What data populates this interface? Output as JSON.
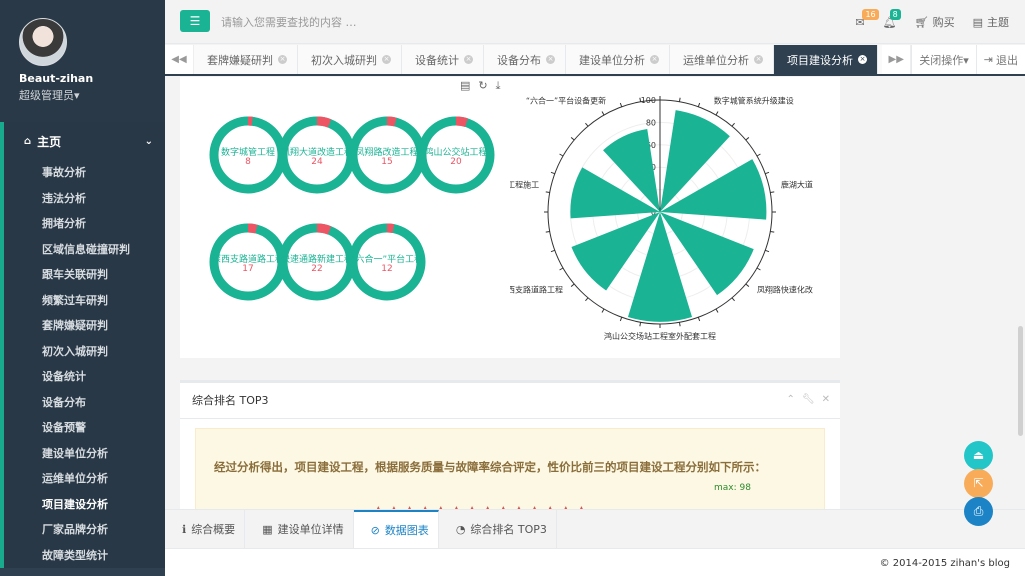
{
  "user": {
    "name": "Beaut-zihan",
    "role": "超级管理员▾"
  },
  "nav": {
    "section": "主页",
    "items": [
      "事故分析",
      "违法分析",
      "拥堵分析",
      "区域信息碰撞研判",
      "跟车关联研判",
      "频繁过车研判",
      "套牌嫌疑研判",
      "初次入城研判",
      "设备统计",
      "设备分布",
      "设备预警",
      "建设单位分析",
      "运维单位分析",
      "项目建设分析",
      "厂家品牌分析",
      "故障类型统计"
    ]
  },
  "search": {
    "placeholder": "请输入您需要查找的内容 …"
  },
  "topright": {
    "mail_count": "16",
    "alert_count": "8",
    "buy": "购买",
    "theme": "主题"
  },
  "tabs": [
    "套牌嫌疑研判",
    "初次入城研判",
    "设备统计",
    "设备分布",
    "建设单位分析",
    "运维单位分析",
    "项目建设分析"
  ],
  "tab_actions": {
    "close_ops": "关闭操作▾",
    "logout": "退出"
  },
  "donuts": [
    {
      "name": "数字城管工程",
      "value": "8",
      "pct": 0.02
    },
    {
      "name": "凤翔大道改造工程",
      "value": "24",
      "pct": 0.06
    },
    {
      "name": "凤翔路改造工程",
      "value": "15",
      "pct": 0.04
    },
    {
      "name": "鸿山公交站工程",
      "value": "20",
      "pct": 0.05
    },
    {
      "name": "深西支路道路工程",
      "value": "17",
      "pct": 0.04
    },
    {
      "name": "快速通路新建工程",
      "value": "22",
      "pct": 0.06
    },
    {
      "name": "“六合一”平台工程",
      "value": "12",
      "pct": 0.03
    }
  ],
  "chart_data": {
    "type": "polar-bar",
    "axis_ticks": [
      "100",
      "80",
      "60",
      "40",
      "20",
      "0"
    ],
    "categories": [
      "数字城管系统升级建设",
      "鹿湖大道",
      "凤翔路快速化改",
      "鸿山公交场站工程室外配套工程",
      "深西支路道路工程",
      "工程施工",
      "“六合一”平台设备更新"
    ],
    "values": [
      92,
      95,
      90,
      98,
      85,
      80,
      75
    ],
    "colors": {
      "bar": "#1ab394",
      "donut": "#1ab394",
      "donut_accent": "#ed5565"
    }
  },
  "panel2": {
    "title": "综合排名 TOP3",
    "message": "经过分析得出，项目建设工程，根据服务质量与故障率综合评定，性价比前三的项目建设工程分别如下所示：",
    "max_label": "max: 98"
  },
  "bottom_tabs": [
    "综合概要",
    "建设单位详情",
    "数据图表",
    "综合排名 TOP3"
  ],
  "footer": "© 2014-2015 zihan's blog"
}
